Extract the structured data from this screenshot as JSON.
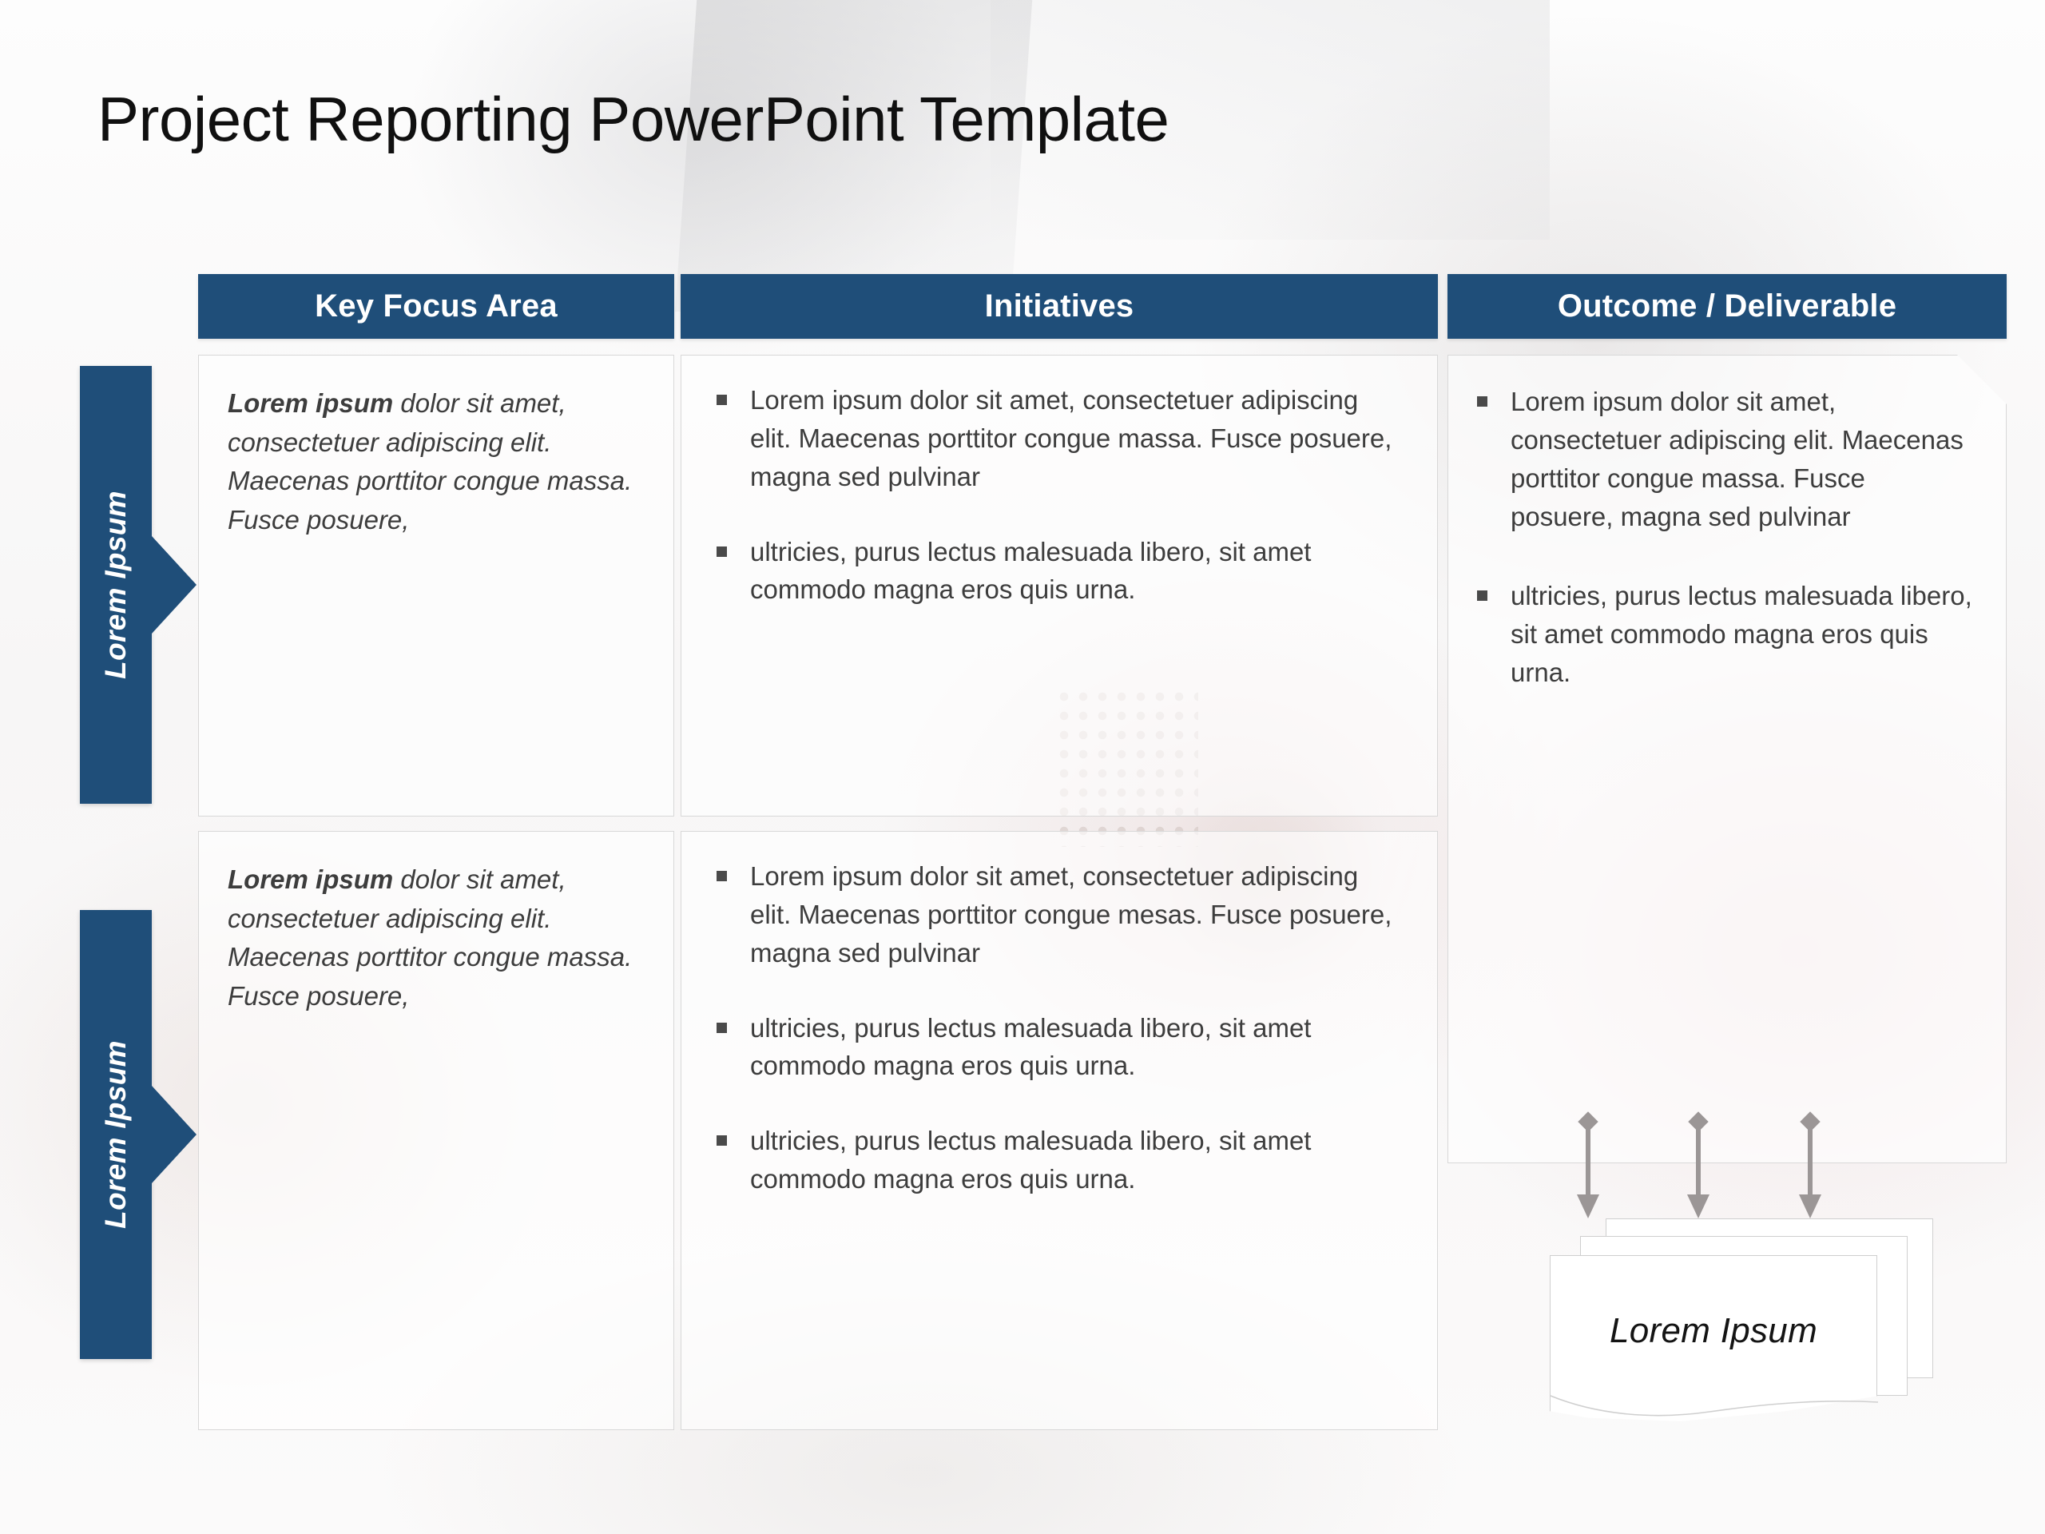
{
  "slide": {
    "title": "Project Reporting PowerPoint Template",
    "accent_color": "#1F4E79",
    "text_color": "#3d3d3d",
    "arrow_color": "#9b9696"
  },
  "columns": [
    {
      "id": "key-focus-area",
      "label": "Key Focus Area"
    },
    {
      "id": "initiatives",
      "label": "Initiatives"
    },
    {
      "id": "outcome",
      "label": "Outcome / Deliverable"
    }
  ],
  "lanes": [
    {
      "id": "lane-1",
      "label": "Lorem Ipsum"
    },
    {
      "id": "lane-2",
      "label": "Lorem Ipsum"
    }
  ],
  "rows": [
    {
      "key_focus": {
        "lead": "Lorem ipsum",
        "rest": " dolor sit amet, consectetuer adipiscing elit. Maecenas porttitor congue massa. Fusce posuere,"
      },
      "initiatives": [
        "Lorem ipsum dolor sit amet, consectetuer adipiscing elit. Maecenas porttitor congue massa. Fusce posuere, magna sed pulvinar",
        "ultricies, purus lectus malesuada libero, sit amet commodo magna eros quis urna."
      ]
    },
    {
      "key_focus": {
        "lead": "Lorem ipsum",
        "rest": " dolor sit amet, consectetuer adipiscing elit. Maecenas porttitor congue massa. Fusce posuere,"
      },
      "initiatives": [
        "Lorem ipsum dolor sit amet, consectetuer adipiscing elit. Maecenas porttitor congue mesas. Fusce posuere, magna sed pulvinar",
        "ultricies, purus lectus malesuada libero, sit amet commodo magna eros quis urna.",
        "ultricies, purus lectus malesuada libero, sit amet commodo magna eros quis urna."
      ]
    }
  ],
  "outcome": {
    "bullets": [
      "Lorem ipsum dolor sit amet, consectetuer adipiscing elit. Maecenas porttitor congue massa. Fusce posuere, magna sed pulvinar",
      "ultricies, purus lectus malesuada libero, sit amet commodo magna eros quis urna."
    ]
  },
  "deliverable_stack": {
    "label": "Lorem Ipsum",
    "arrow_count": 3,
    "card_count": 3
  }
}
